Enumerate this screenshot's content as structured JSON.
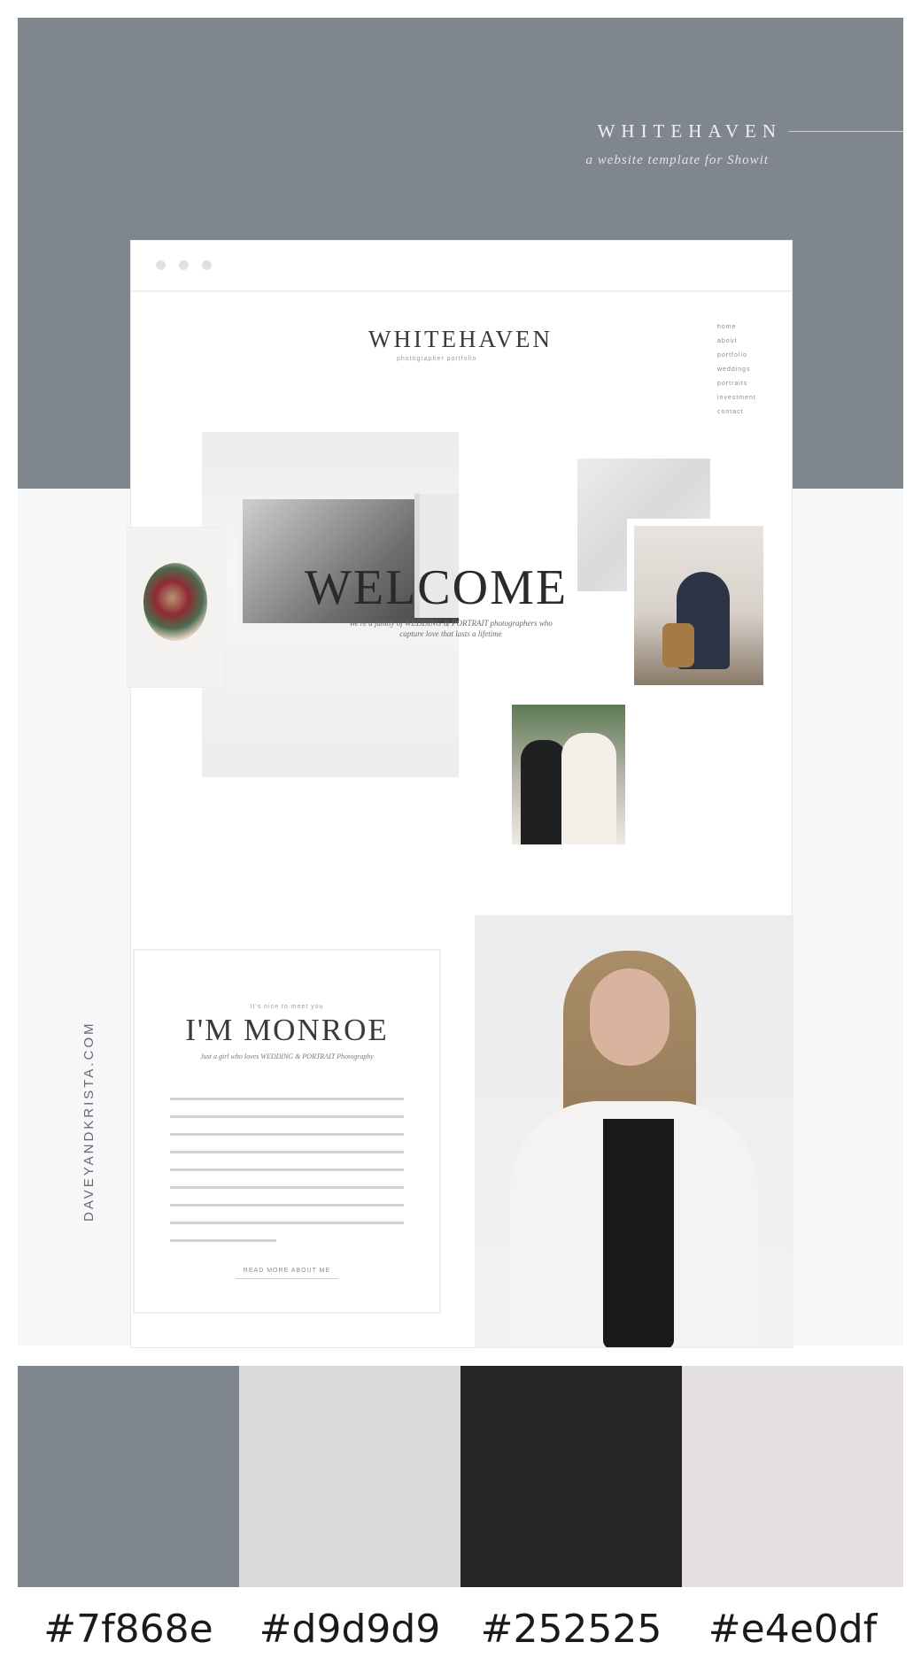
{
  "header": {
    "brand": "WHITEHAVEN",
    "tagline": "a website template for Showit"
  },
  "mockup": {
    "site_title": "WHITEHAVEN",
    "site_subtitle": "photographer portfolio",
    "nav_items": [
      "home",
      "about",
      "portfolio",
      "weddings",
      "portraits",
      "investment",
      "contact"
    ],
    "welcome_title": "WELCOME",
    "welcome_text": "We're a family of WEDDING & PORTRAIT photographers who capture love that lasts a lifetime",
    "about_pretitle": "It's nice to meet you",
    "about_name": "I'M MONROE",
    "about_desc": "Just a girl who loves WEDDING & PORTRAIT Photography",
    "read_more": "READ MORE ABOUT ME"
  },
  "credit": "DAVEYANDKRISTA.COM",
  "palette": [
    {
      "hex": "#7f868e",
      "color": "#7f868e"
    },
    {
      "hex": "#d9d9d9",
      "color": "#d9d9d9"
    },
    {
      "hex": "#252525",
      "color": "#252525"
    },
    {
      "hex": "#e4e0df",
      "color": "#e4e0df"
    }
  ]
}
